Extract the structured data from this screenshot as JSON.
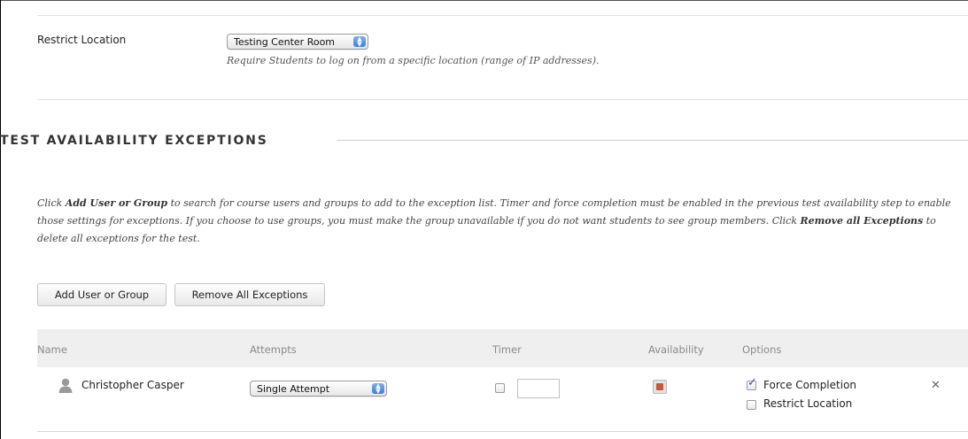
{
  "settings": {
    "restrict_location": {
      "label": "Restrict Location",
      "selected": "Testing Center Room",
      "hint": "Require Students to log on from a specific location (range of IP addresses)."
    }
  },
  "exceptions": {
    "title": "TEST AVAILABILITY EXCEPTIONS",
    "description": {
      "p1": "Click ",
      "b1": "Add User or Group",
      "p2": " to search for course users and groups to add to the exception list. Timer and force completion must be enabled in the previous test availability step to enable those settings for exceptions. If you choose to use groups, you must make the group unavailable if you do not want students to see group members. Click ",
      "b2": "Remove all Exceptions",
      "p3": " to delete all exceptions for the test."
    },
    "buttons": {
      "add": "Add User or Group",
      "remove_all": "Remove All Exceptions"
    },
    "columns": [
      "Name",
      "Attempts",
      "Timer",
      "Availability",
      "Options"
    ],
    "rows": [
      {
        "name": "Christopher Casper",
        "attempts": "Single Attempt",
        "timer_checked": false,
        "timer_value": "",
        "options": {
          "force_completion_label": "Force Completion",
          "force_completion_checked": true,
          "restrict_location_label": "Restrict Location",
          "restrict_location_checked": false
        }
      }
    ]
  },
  "icons": {
    "remove_row": "close-icon",
    "user": "user-icon",
    "availability": "availability-icon"
  },
  "colors": {
    "header_bg": "#efefef",
    "checkmark": "#1d5fc8",
    "select_arrow": "#3d7fd9"
  }
}
